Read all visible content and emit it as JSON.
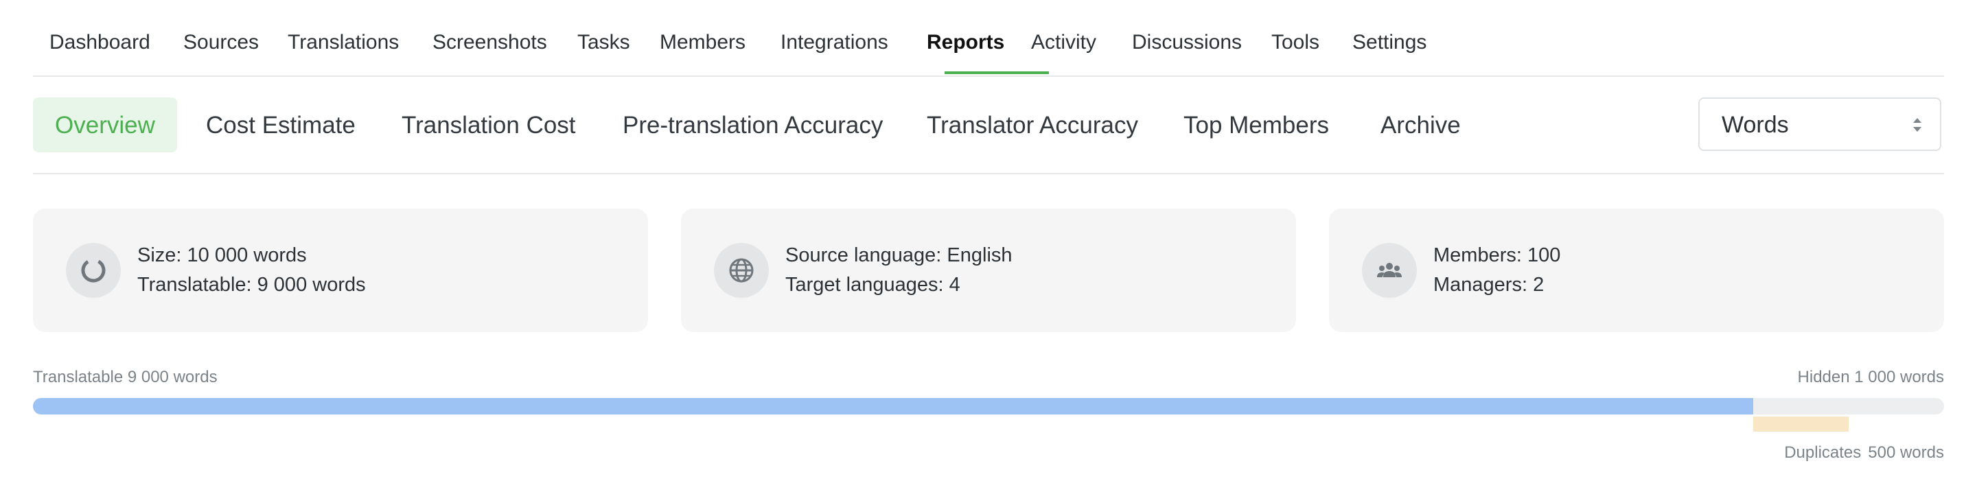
{
  "nav": {
    "items": [
      {
        "label": "Dashboard",
        "active": false
      },
      {
        "label": "Sources",
        "active": false
      },
      {
        "label": "Translations",
        "active": false
      },
      {
        "label": "Screenshots",
        "active": false
      },
      {
        "label": "Tasks",
        "active": false
      },
      {
        "label": "Members",
        "active": false
      },
      {
        "label": "Integrations",
        "active": false
      },
      {
        "label": "Reports",
        "active": true
      },
      {
        "label": "Activity",
        "active": false
      },
      {
        "label": "Discussions",
        "active": false
      },
      {
        "label": "Tools",
        "active": false
      },
      {
        "label": "Settings",
        "active": false
      }
    ]
  },
  "subnav": {
    "tabs": [
      {
        "label": "Overview",
        "active": true
      },
      {
        "label": "Cost Estimate",
        "active": false
      },
      {
        "label": "Translation Cost",
        "active": false
      },
      {
        "label": "Pre-translation Accuracy",
        "active": false
      },
      {
        "label": "Translator Accuracy",
        "active": false
      },
      {
        "label": "Top Members",
        "active": false
      },
      {
        "label": "Archive",
        "active": false
      }
    ],
    "unit_select": {
      "value": "Words"
    }
  },
  "cards": [
    {
      "icon": "progress-ring-icon",
      "line1": "Size: 10 000 words",
      "line2": "Translatable: 9 000 words"
    },
    {
      "icon": "globe-icon",
      "line1": "Source language: English",
      "line2": "Target languages: 4"
    },
    {
      "icon": "users-group-icon",
      "line1": "Members: 100",
      "line2": "Managers: 2"
    }
  ],
  "progress": {
    "translatable_label": "Translatable 9 000 words",
    "hidden_label": "Hidden 1 000 words",
    "duplicates_label": "Duplicates",
    "duplicates_value": "500 words",
    "translatable_fraction": 0.9,
    "duplicates_fraction": 0.05
  },
  "colors": {
    "accent": "#4caf50",
    "progress_translatable": "#9dc3f5",
    "progress_duplicates": "#f8e6c4",
    "card_bg": "#f5f5f5"
  }
}
